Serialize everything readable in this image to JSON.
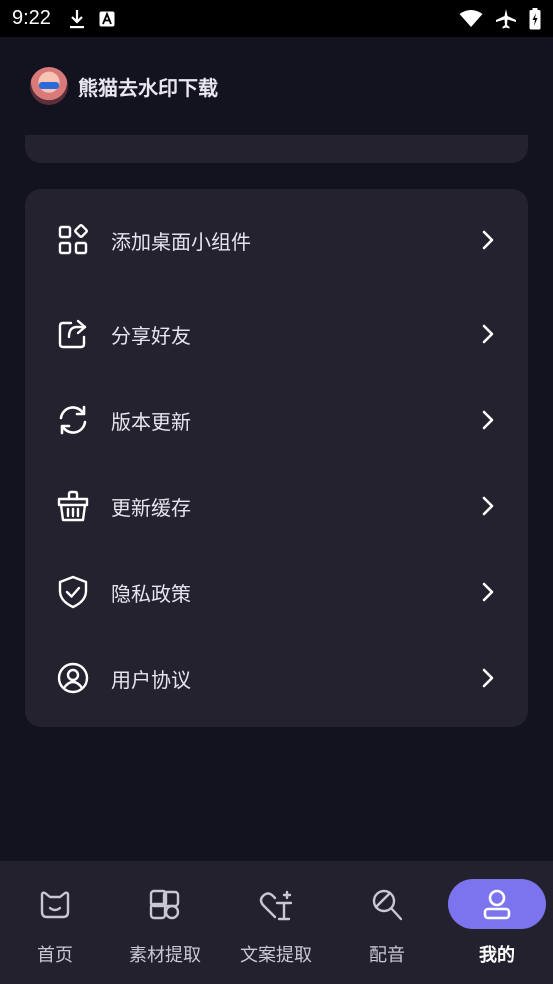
{
  "status_bar": {
    "time": "9:22",
    "icons_left": [
      "download-icon",
      "font-a-icon"
    ],
    "icons_right": [
      "wifi-icon",
      "airplane-icon",
      "battery-icon"
    ]
  },
  "header": {
    "app_name": "熊猫去水印下载"
  },
  "menu": {
    "items": [
      {
        "label": "添加桌面小组件",
        "icon": "widgets-icon"
      },
      {
        "label": "分享好友",
        "icon": "share-icon"
      },
      {
        "label": "版本更新",
        "icon": "refresh-icon"
      },
      {
        "label": "更新缓存",
        "icon": "basket-icon"
      },
      {
        "label": "隐私政策",
        "icon": "shield-check-icon"
      },
      {
        "label": "用户协议",
        "icon": "user-circle-icon"
      }
    ]
  },
  "bottom_nav": {
    "items": [
      {
        "label": "首页",
        "icon": "home-icon",
        "active": false
      },
      {
        "label": "素材提取",
        "icon": "material-icon",
        "active": false
      },
      {
        "label": "文案提取",
        "icon": "text-extract-icon",
        "active": false
      },
      {
        "label": "配音",
        "icon": "microphone-icon",
        "active": false
      },
      {
        "label": "我的",
        "icon": "profile-icon",
        "active": true
      }
    ]
  },
  "colors": {
    "background": "#13121f",
    "card": "#24222f",
    "nav_background": "#23212e",
    "accent": "#7b74ee"
  }
}
